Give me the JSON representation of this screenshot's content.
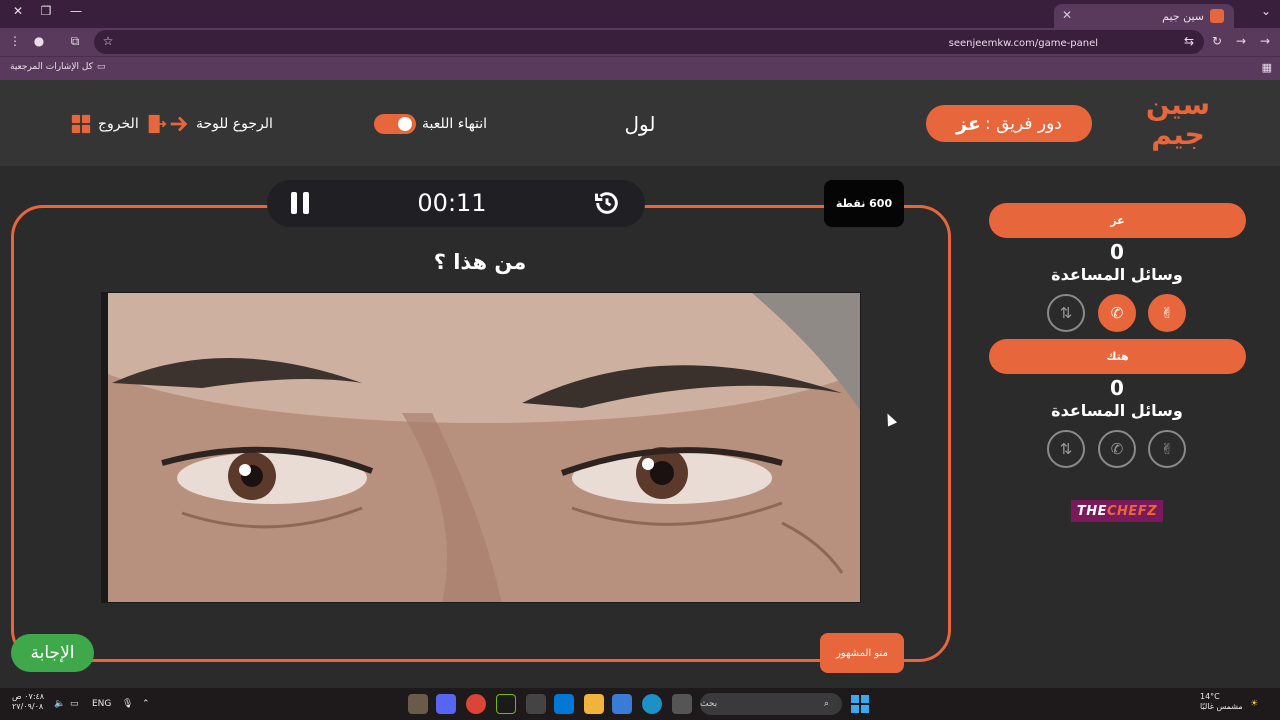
{
  "browser": {
    "tab_title": "سين جيم",
    "url": "seenjeemkw.com/game-panel",
    "bookmark_label": "كل الإشارات المرجعية"
  },
  "header": {
    "logo_text": "سين جيم",
    "turn_prefix": "دور فريق :",
    "turn_team": "عز",
    "game_name": "لول",
    "end_game_label": "انتهاء اللعبة",
    "back_to_board_label": "الرجوع للوحة",
    "exit_label": "الخروج"
  },
  "board": {
    "timer": "00:11",
    "points": "600 نقطة",
    "question": "من هذا ؟",
    "category": "منو المشهور",
    "answer_label": "الإجابة",
    "image_alt": "close-up of a man's eyes"
  },
  "teams": [
    {
      "name": "عز",
      "score": "0",
      "helps_label": "وسائل المساعدة",
      "helps": [
        {
          "icon": "peace-hand-icon",
          "active": true
        },
        {
          "icon": "phone-icon",
          "active": true
        },
        {
          "icon": "swap-phone-icon",
          "active": false
        }
      ]
    },
    {
      "name": "هتك",
      "score": "0",
      "helps_label": "وسائل المساعدة",
      "helps": [
        {
          "icon": "peace-hand-icon",
          "active": false
        },
        {
          "icon": "phone-icon",
          "active": false
        },
        {
          "icon": "swap-phone-icon",
          "active": false
        }
      ]
    }
  ],
  "sponsor": {
    "part1": "THE ",
    "part2": "CHEFZ"
  },
  "taskbar": {
    "weather_temp": "14°C",
    "weather_desc": "مشمس غالبًا",
    "search_placeholder": "بحث",
    "lang": "ENG",
    "time": "٠٧:٤٨ ص",
    "date": "٢٧/٠٩/٠٨"
  },
  "colors": {
    "accent": "#e8663c",
    "answer_green": "#3fa84a",
    "background": "#2b2b2b",
    "browser_purple": "#5a3a5c"
  }
}
